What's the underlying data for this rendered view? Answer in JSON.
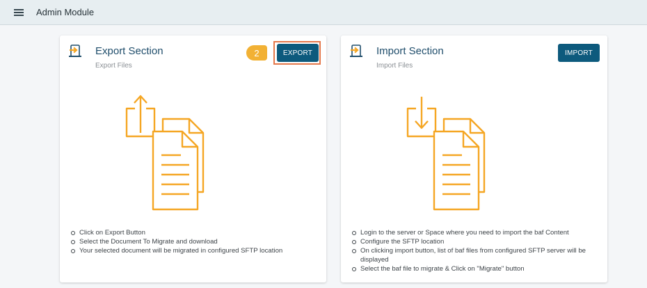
{
  "header": {
    "title": "Admin Module",
    "menu_icon": "hamburger-menu-icon"
  },
  "export": {
    "title": "Export Section",
    "subtitle": "Export Files",
    "button_label": "EXPORT",
    "step_number": "2",
    "icon": "export-file-icon",
    "illustration": "export-document-illustration",
    "steps": [
      "Click on Export Button",
      "Select the Document To Migrate and download",
      "Your selected document will be migrated in configured SFTP location"
    ]
  },
  "import": {
    "title": "Import Section",
    "subtitle": "Import Files",
    "button_label": "IMPORT",
    "icon": "import-file-icon",
    "illustration": "import-document-illustration",
    "steps": [
      "Login to the server or Space where you need to import the baf Content",
      "Configure the SFTP location",
      "On clicking import button, list of baf files from configured SFTP server will be displayed",
      "Select the baf file to migrate & Click on \"Migrate\" button"
    ]
  },
  "colors": {
    "accent_orange": "#f5a623",
    "button_blue": "#0d5a7d",
    "title_blue": "#1f4d6b",
    "highlight": "#e4774a",
    "badge": "#f2b134"
  }
}
